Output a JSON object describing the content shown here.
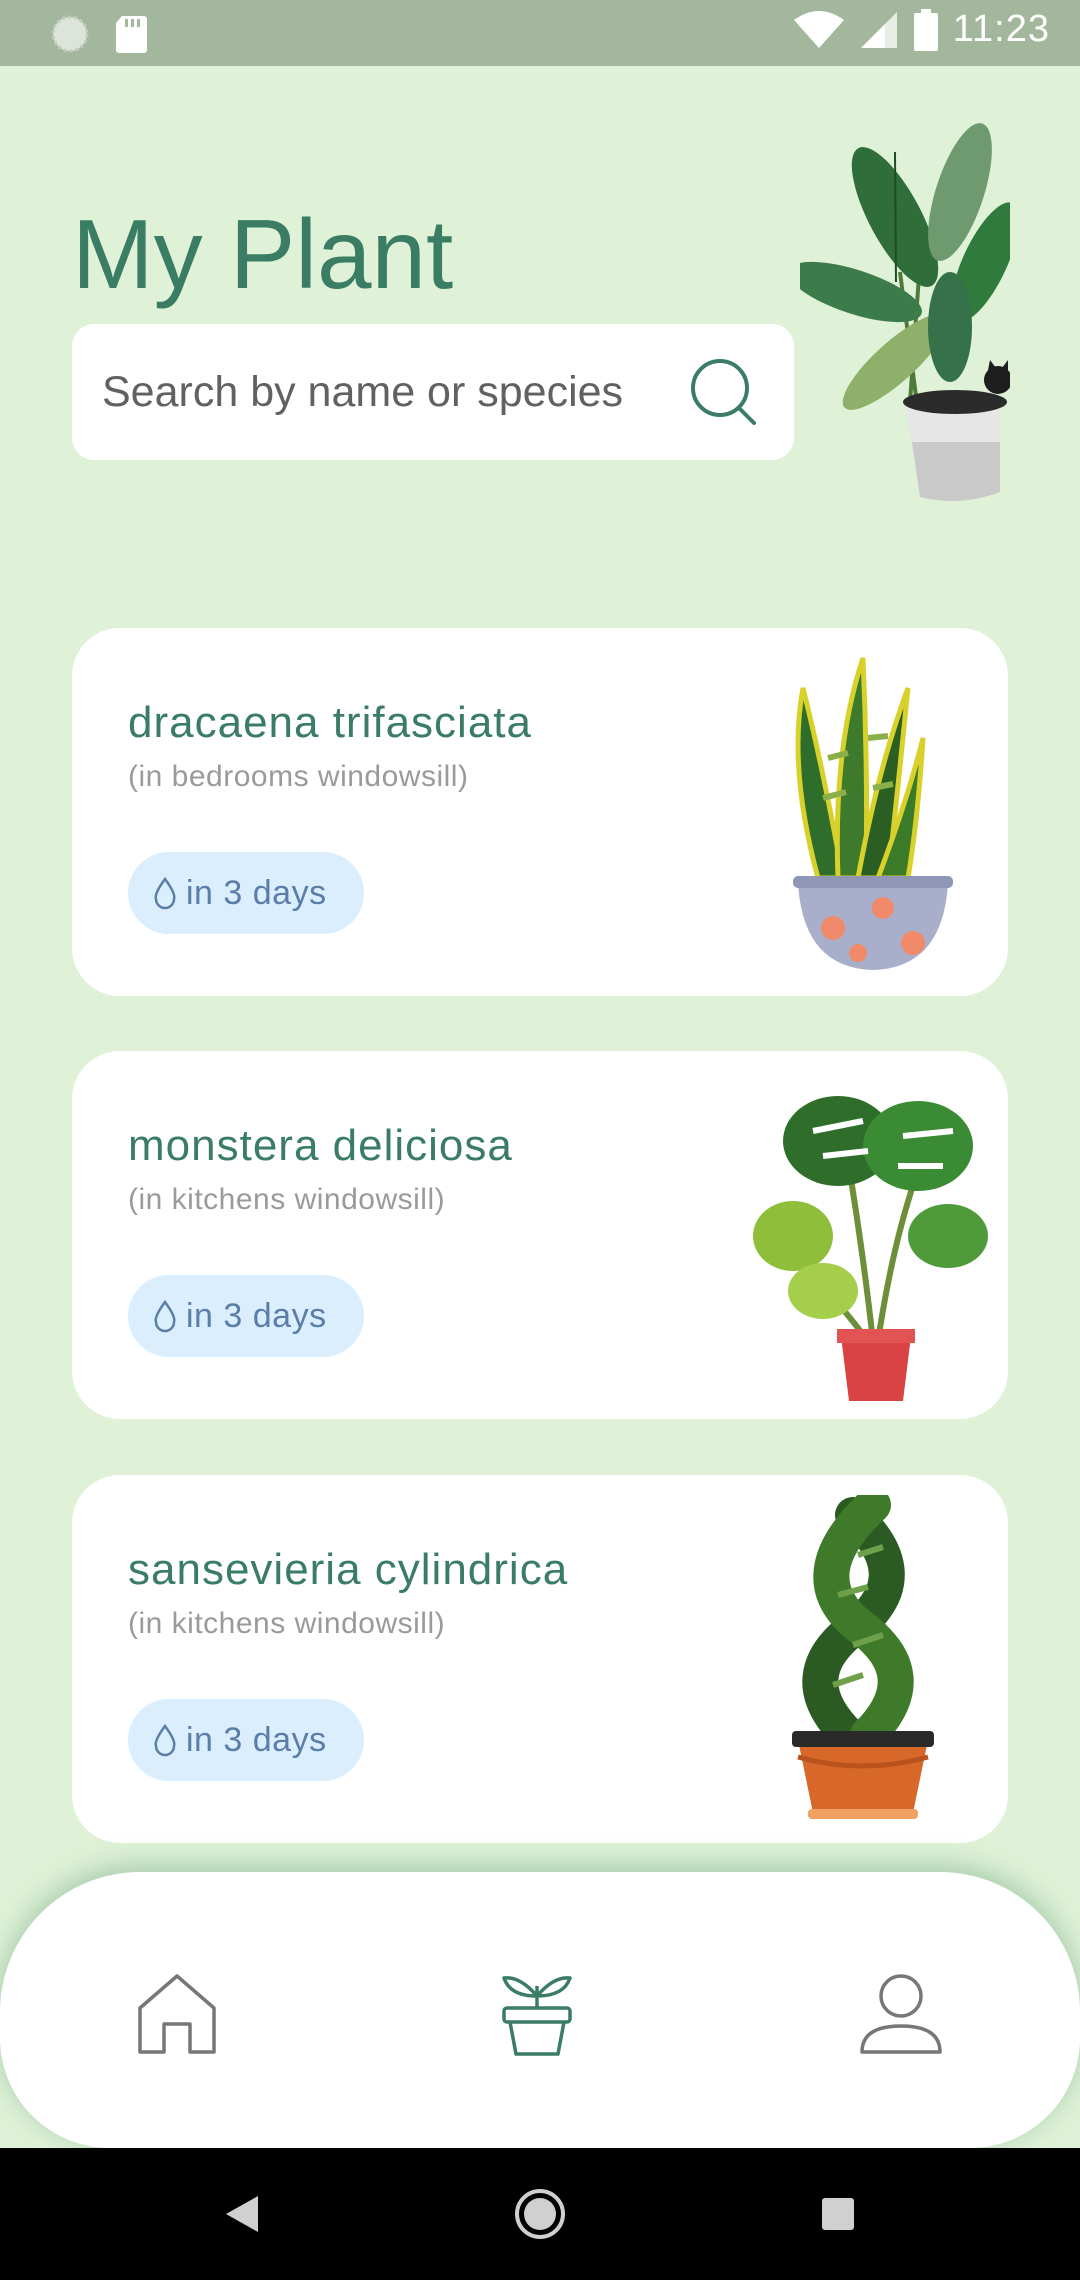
{
  "status_bar": {
    "time": "11:23",
    "icons": [
      "notification-icon",
      "sd-card-icon",
      "wifi-icon",
      "signal-icon",
      "battery-icon"
    ]
  },
  "header": {
    "title": "My Plant",
    "search": {
      "placeholder": "Search by name or species",
      "value": ""
    }
  },
  "plants": [
    {
      "name": "dracaena trifasciata",
      "location": "(in bedrooms windowsill)",
      "water": "in 3 days",
      "art": "snake-plant"
    },
    {
      "name": "monstera deliciosa",
      "location": "(in kitchens windowsill)",
      "water": "in 3 days",
      "art": "monstera"
    },
    {
      "name": "sansevieria cylindrica",
      "location": "(in kitchens windowsill)",
      "water": "in 3 days",
      "art": "braided-sansevieria"
    }
  ],
  "bottom_nav": {
    "items": [
      "home-icon",
      "plant-pot-icon",
      "profile-icon"
    ],
    "active": "plant-pot-icon"
  },
  "colors": {
    "background": "#dff2d7",
    "accent": "#3a7d64",
    "chip_bg": "#dbeefe",
    "chip_text": "#5a7ea8"
  }
}
